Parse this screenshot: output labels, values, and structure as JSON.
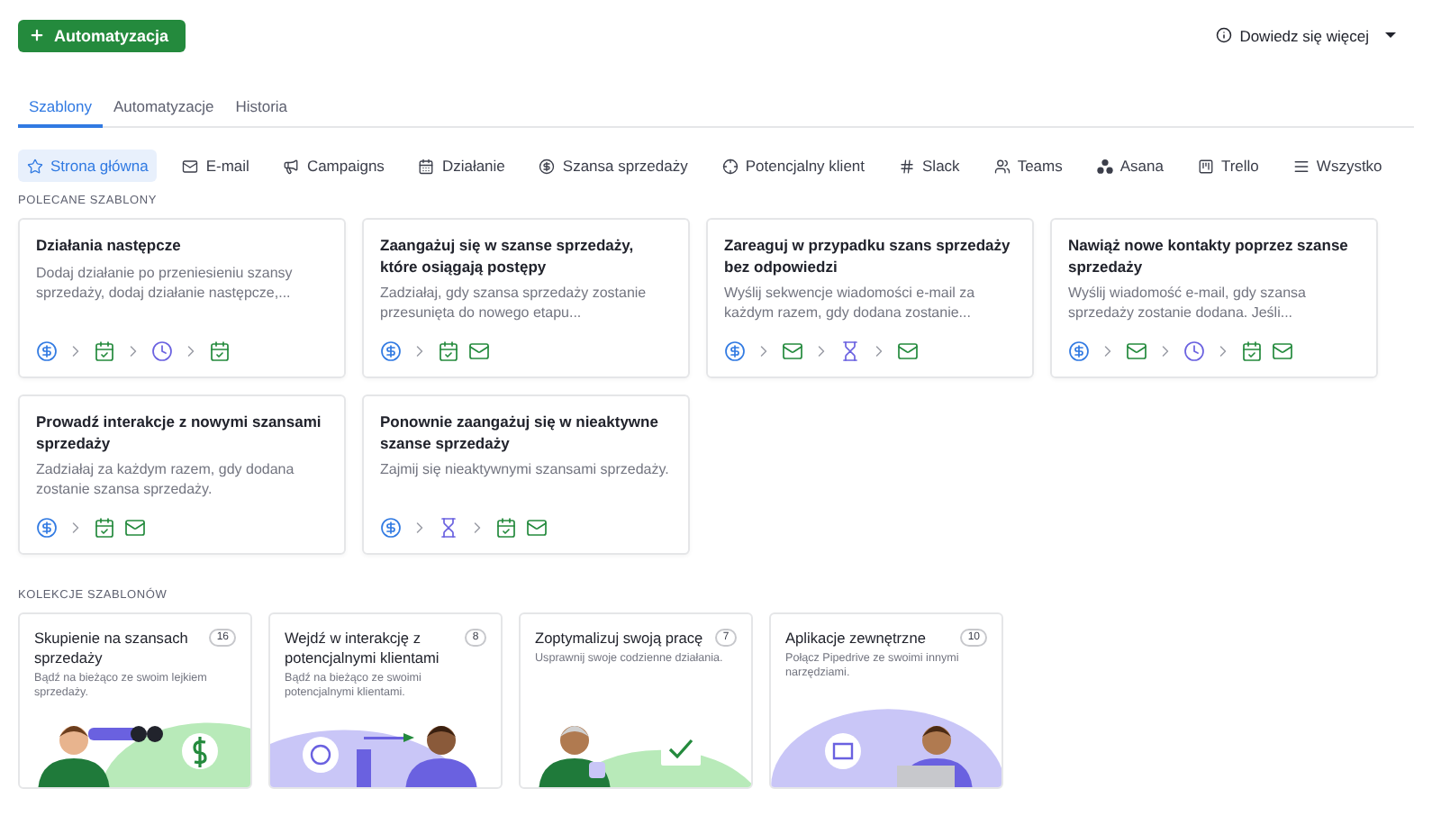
{
  "header": {
    "create_button": "Automatyzacja",
    "learn_more": "Dowiedz się więcej"
  },
  "tabs": [
    {
      "label": "Szablony",
      "selected": true
    },
    {
      "label": "Automatyzacje",
      "selected": false
    },
    {
      "label": "Historia",
      "selected": false
    }
  ],
  "filters": [
    {
      "kind": "star",
      "label": "Strona główna",
      "selected": true
    },
    {
      "kind": "mail",
      "label": "E-mail",
      "selected": false
    },
    {
      "kind": "megaphone",
      "label": "Campaigns",
      "selected": false
    },
    {
      "kind": "calendar",
      "label": "Działanie",
      "selected": false
    },
    {
      "kind": "dollar",
      "label": "Szansa sprzedaży",
      "selected": false
    },
    {
      "kind": "target",
      "label": "Potencjalny klient",
      "selected": false
    },
    {
      "kind": "slack",
      "label": "Slack",
      "selected": false
    },
    {
      "kind": "teams",
      "label": "Teams",
      "selected": false
    },
    {
      "kind": "asana",
      "label": "Asana",
      "selected": false
    },
    {
      "kind": "trello",
      "label": "Trello",
      "selected": false
    },
    {
      "kind": "list",
      "label": "Wszystko",
      "selected": false
    }
  ],
  "featured": {
    "heading": "POLECANE SZABLONY",
    "templates": [
      {
        "title": "Działania następcze",
        "description": "Dodaj działanie po przeniesieniu szansy sprzedaży, dodaj działanie następcze,...",
        "steps": [
          {
            "kind": "deal"
          },
          {
            "kind": "arrow"
          },
          {
            "kind": "activity"
          },
          {
            "kind": "arrow"
          },
          {
            "kind": "delay"
          },
          {
            "kind": "arrow"
          },
          {
            "kind": "activity"
          }
        ]
      },
      {
        "title": "Zaangażuj się w szanse sprzedaży, które osiągają postępy",
        "description": "Zadziałaj, gdy szansa sprzedaży zostanie przesunięta do nowego etapu...",
        "steps": [
          {
            "kind": "deal"
          },
          {
            "kind": "arrow"
          },
          {
            "kind": "activity"
          },
          {
            "kind": "email"
          }
        ]
      },
      {
        "title": "Zareaguj w przypadku szans sprzedaży bez odpowiedzi",
        "description": "Wyślij sekwencje wiadomości e-mail za każdym razem, gdy dodana zostanie...",
        "steps": [
          {
            "kind": "deal"
          },
          {
            "kind": "arrow"
          },
          {
            "kind": "email"
          },
          {
            "kind": "arrow"
          },
          {
            "kind": "wait"
          },
          {
            "kind": "arrow"
          },
          {
            "kind": "email"
          }
        ]
      },
      {
        "title": "Nawiąż nowe kontakty poprzez szanse sprzedaży",
        "description": "Wyślij wiadomość e-mail, gdy szansa sprzedaży zostanie dodana. Jeśli...",
        "steps": [
          {
            "kind": "deal"
          },
          {
            "kind": "arrow"
          },
          {
            "kind": "email"
          },
          {
            "kind": "arrow"
          },
          {
            "kind": "delay"
          },
          {
            "kind": "arrow"
          },
          {
            "kind": "activity"
          },
          {
            "kind": "email"
          }
        ]
      },
      {
        "title": "Prowadź interakcje z nowymi szansami sprzedaży",
        "description": "Zadziałaj za każdym razem, gdy dodana zostanie szansa sprzedaży.",
        "steps": [
          {
            "kind": "deal"
          },
          {
            "kind": "arrow"
          },
          {
            "kind": "activity"
          },
          {
            "kind": "email"
          }
        ]
      },
      {
        "title": "Ponownie zaangażuj się w nieaktywne szanse sprzedaży",
        "description": "Zajmij się nieaktywnymi szansami sprzedaży.",
        "steps": [
          {
            "kind": "deal"
          },
          {
            "kind": "arrow"
          },
          {
            "kind": "wait"
          },
          {
            "kind": "arrow"
          },
          {
            "kind": "activity"
          },
          {
            "kind": "email"
          }
        ]
      }
    ]
  },
  "collections": {
    "heading": "KOLEKCJE SZABLONÓW",
    "items": [
      {
        "kind": "binoculars",
        "title": "Skupienie na szansach sprzedaży",
        "count": "16",
        "description": "Bądź na bieżąco ze swoim lejkiem sprzedaży."
      },
      {
        "kind": "dart",
        "title": "Wejdź w interakcję z potencjalnymi klientami",
        "count": "8",
        "description": "Bądź na bieżąco ze swoimi potencjalnymi klientami."
      },
      {
        "kind": "coffee",
        "title": "Zoptymalizuj swoją pracę",
        "count": "7",
        "description": "Usprawnij swoje codzienne działania."
      },
      {
        "kind": "laptop",
        "title": "Aplikacje zewnętrzne",
        "count": "10",
        "description": "Połącz Pipedrive ze swoimi innymi narzędziami."
      }
    ]
  }
}
